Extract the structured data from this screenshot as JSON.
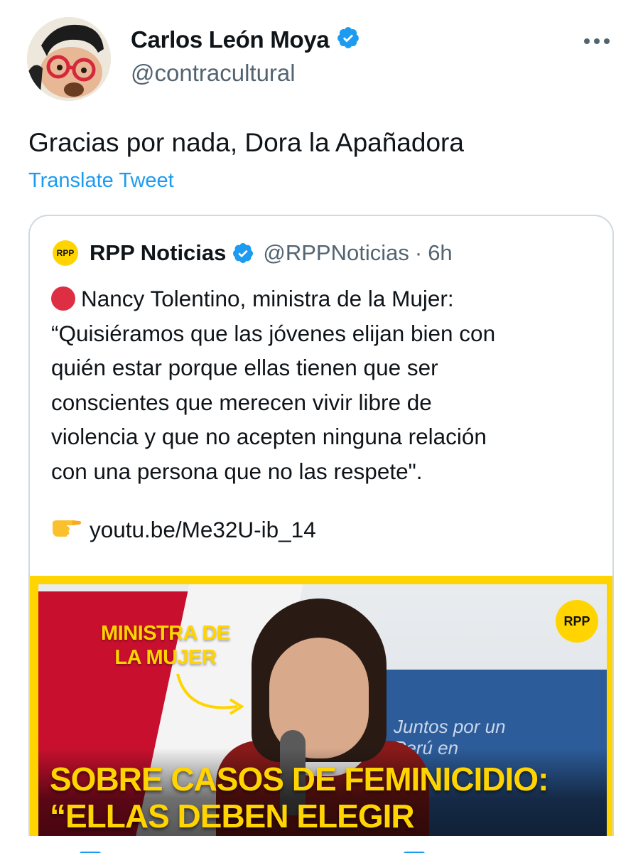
{
  "author": {
    "display_name": "Carlos León Moya",
    "handle": "@contracultural",
    "verified": true
  },
  "tweet": {
    "text": "Gracias por nada, Dora la Apañadora",
    "translate_label": "Translate Tweet"
  },
  "quoted_tweet": {
    "display_name": "RPP Noticias",
    "handle": "@RPPNoticias",
    "separator": "·",
    "time": "6h",
    "logo_text": "RPP",
    "body_lines": [
      "Nancy Tolentino, ministra de la Mujer:",
      "“Quisiéramos que las jóvenes elijan bien con",
      "quién estar porque ellas tienen que ser",
      "conscientes que merecen vivir libre de",
      "violencia y que no acepten ninguna relación",
      "con una persona que no las respete\"."
    ],
    "link": "youtu.be/Me32U-ib_14",
    "media": {
      "label_line1": "MINISTRA DE",
      "label_line2": "LA MUJER",
      "logo_text": "RPP",
      "banner_line1": "Juntos por un",
      "banner_line2": "Perú en",
      "headline_line1": "SOBRE CASOS DE FEMINICIDIO:",
      "headline_line2": "“ELLAS DEBEN ELEGIR"
    }
  },
  "colors": {
    "accent": "#1d9bf0",
    "verified": "#1d9bf0",
    "muted_text": "#536471",
    "border": "#cfd9de",
    "rpp_yellow": "#ffd400",
    "red_dot": "#dd2e44"
  },
  "icons": {
    "verified": "verified-badge-icon",
    "more": "more-horizontal-icon",
    "red_circle": "red-circle-icon",
    "pointing_hand": "pointing-right-hand-icon"
  }
}
